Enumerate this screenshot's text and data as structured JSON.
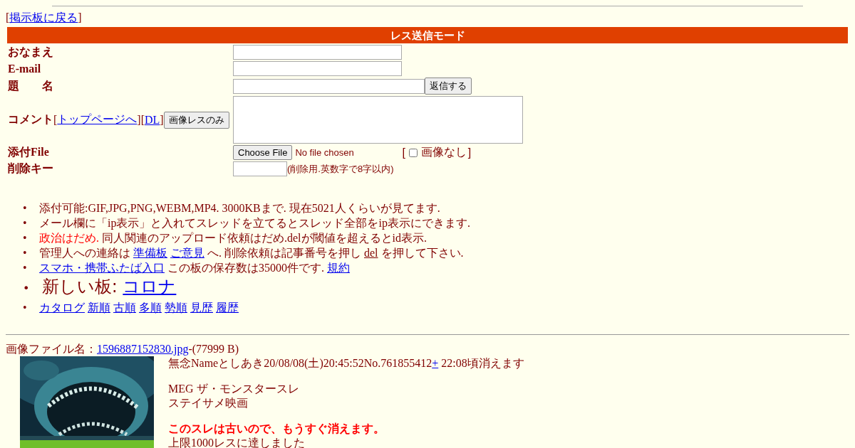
{
  "back_link": {
    "open": "[",
    "label": "掲示板に戻る",
    "close": "]"
  },
  "form": {
    "title": "レス送信モード",
    "name_label": "おなまえ",
    "email_label": "E-mail",
    "subject_label": "題　　名",
    "submit_button": "返信する",
    "comment_label": "コメント",
    "comment_links": [
      {
        "open": "[",
        "label": "トップページへ",
        "close": "]"
      },
      {
        "open": "[",
        "label": "DL",
        "close": "]"
      }
    ],
    "image_only_button": "画像レスのみ",
    "file_label": "添付File",
    "file_button": "Choose File",
    "file_status": "No file chosen",
    "no_image": {
      "open": "[",
      "label": "画像なし",
      "close": "]",
      "checked": false
    },
    "delete_key_label": "削除キー",
    "delete_key_note": "(削除用.英数字で8字以内)"
  },
  "notice_bullet": "•",
  "notices": [
    {
      "kind": "normal",
      "parts": [
        {
          "kind": "text",
          "text": "添付可能:GIF,JPG,PNG,WEBM,MP4. 3000KBまで. 現在5021人くらいが見てます."
        }
      ]
    },
    {
      "kind": "normal",
      "parts": [
        {
          "kind": "text",
          "text": "メール欄に「ip表示」と入れてスレッドを立てるとスレッド全部をip表示にできます."
        }
      ]
    },
    {
      "kind": "normal",
      "parts": [
        {
          "kind": "alert",
          "text": "政治はだめ."
        },
        {
          "kind": "text",
          "text": "同人関連のアップロード依頼はだめ.delが閾値を超えるとid表示."
        }
      ]
    },
    {
      "kind": "normal",
      "parts": [
        {
          "kind": "text",
          "text": "管理人への連絡は"
        },
        {
          "kind": "link",
          "text": "準備板"
        },
        {
          "kind": "link",
          "text": "ご意見"
        },
        {
          "kind": "text",
          "text": "へ. 削除依頼は記事番号を押し"
        },
        {
          "kind": "underline",
          "text": "del"
        },
        {
          "kind": "text",
          "text": "を押して下さい."
        }
      ]
    },
    {
      "kind": "normal",
      "parts": [
        {
          "kind": "link",
          "text": "スマホ・携帯ふたば入口"
        },
        {
          "kind": "text",
          "text": "この板の保存数は35000件です."
        },
        {
          "kind": "link",
          "text": "規約"
        }
      ]
    },
    {
      "kind": "large",
      "parts": [
        {
          "kind": "text",
          "text": "新しい板:"
        },
        {
          "kind": "link",
          "text": "コロナ"
        }
      ]
    },
    {
      "kind": "normal",
      "parts": [
        {
          "kind": "link",
          "text": "カタログ"
        },
        {
          "kind": "link",
          "text": "新順"
        },
        {
          "kind": "link",
          "text": "古順"
        },
        {
          "kind": "link",
          "text": "多順"
        },
        {
          "kind": "link",
          "text": "勢順"
        },
        {
          "kind": "link",
          "text": "見歴"
        },
        {
          "kind": "link",
          "text": "履歴"
        }
      ]
    }
  ],
  "post": {
    "file_label": "画像ファイル名：",
    "file_link": "1596887152830.jpg",
    "file_size": "-(77999 B)",
    "thumbnail": {
      "kind": "picture"
    },
    "header": "無念Nameとしあき20/08/08(土)20:45:52No.761855412",
    "plus_link": "+",
    "expiry": "22:08頃消えます",
    "lines": [
      "MEG ザ・モンスタースレ",
      "ステイサメ映画"
    ],
    "warning": "このスレは古いので、もうすぐ消えます。",
    "limit_note": "上限1000レスに達しました"
  }
}
